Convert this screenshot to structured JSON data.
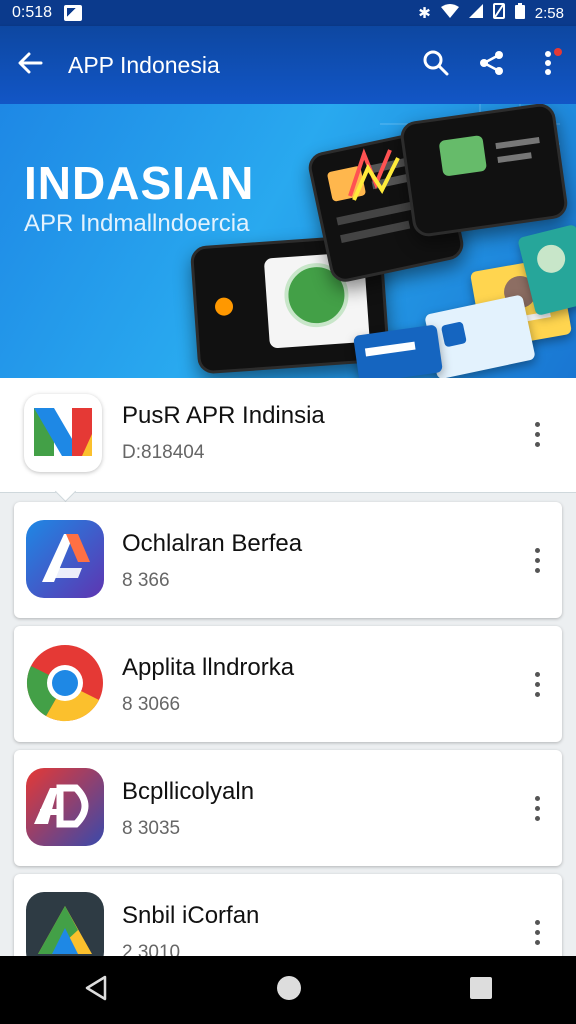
{
  "status_bar": {
    "time": "0:518",
    "right_text": "2:58"
  },
  "app_bar": {
    "title": "APP Indonesia",
    "icons": [
      "back-arrow-icon",
      "search-icon",
      "share-icon",
      "more-vert-icon"
    ]
  },
  "banner": {
    "headline": "INDASIAN",
    "subline": "APR Indmallndoercia"
  },
  "featured": {
    "name": "PusR APR Indinsia",
    "sub": "D:818404",
    "icon": "colorful-n-logo-icon"
  },
  "apps": [
    {
      "name": "Ochlalran Berfea",
      "sub": "8 366",
      "icon": "blue-a-app-icon"
    },
    {
      "name": "Applita llndrorka",
      "sub": "8 3066",
      "icon": "chrome-like-app-icon"
    },
    {
      "name": "Bcpllicolyaln",
      "sub": "8 3035",
      "icon": "red-ad-app-icon"
    },
    {
      "name": "Snbil iCorfan",
      "sub": "2 3010",
      "icon": "dark-triangle-app-icon"
    }
  ],
  "nav_bar": {
    "icons": [
      "nav-back-icon",
      "nav-home-icon",
      "nav-recents-icon"
    ]
  },
  "colors": {
    "app_bar": "#0d47a1",
    "banner": "#1e88e5",
    "nav_bar": "#000000"
  }
}
